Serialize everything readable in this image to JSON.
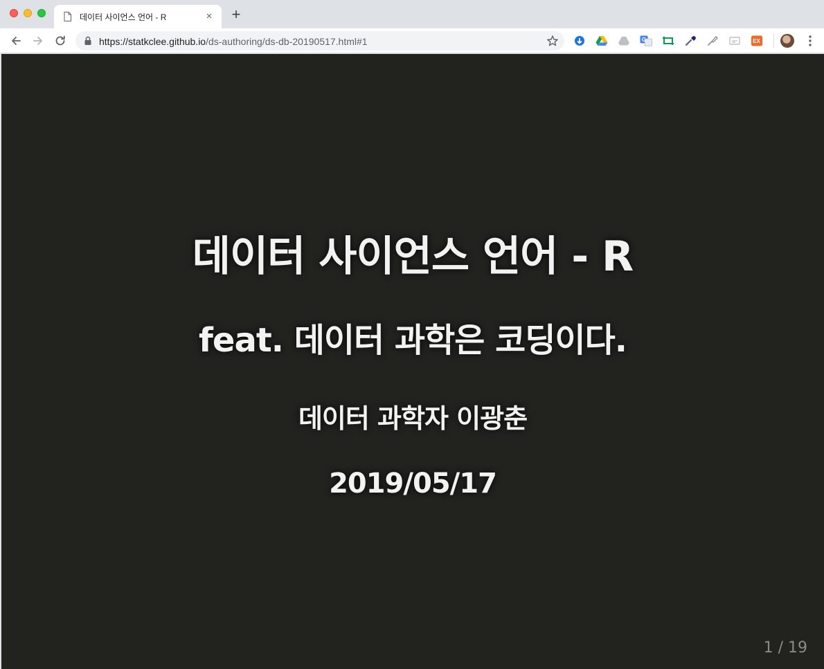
{
  "window": {
    "traffic_lights": [
      "close",
      "minimize",
      "zoom"
    ]
  },
  "tab": {
    "title": "데이터 사이언스 언어 - R",
    "close_glyph": "×",
    "new_tab_glyph": "+"
  },
  "toolbar": {
    "url_host": "https://statkclee.github.io",
    "url_path": "/ds-authoring/ds-db-20190517.html#1",
    "extensions": [
      "download-icon",
      "google-drive-icon",
      "drive-cloud-icon",
      "google-translate-icon",
      "screen-capture-icon",
      "eyedropper-icon",
      "paint-brush-icon",
      "cast-icon",
      "ex-icon"
    ]
  },
  "slide": {
    "title": "데이터 사이언스 언어 - R",
    "subtitle": "feat. 데이터 과학은 코딩이다.",
    "author": "데이터 과학자 이광춘",
    "date": "2019/05/17",
    "counter": "1 / 19"
  },
  "colors": {
    "slide_background": "#22221f",
    "slide_text": "#f2f2f2",
    "counter_text": "#8a8a86"
  }
}
